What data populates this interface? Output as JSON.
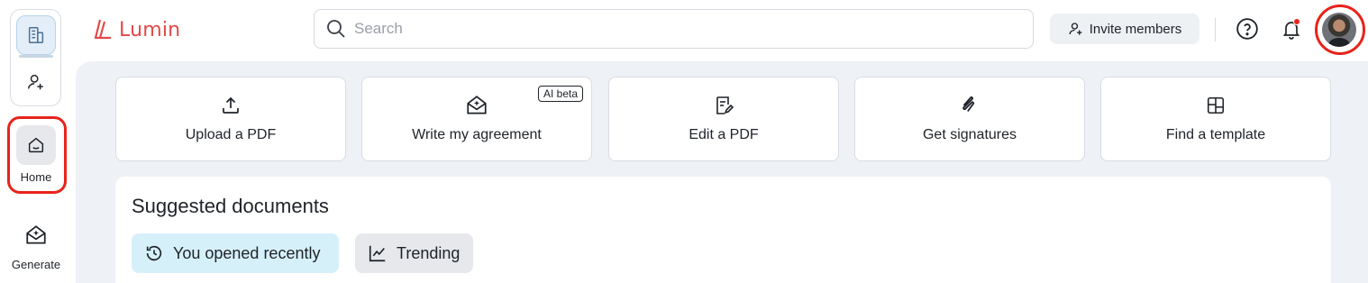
{
  "rail": {
    "workspace_icon": "building-icon",
    "add_member_icon": "user-plus-icon",
    "home_label": "Home",
    "home_icon": "home-icon",
    "generate_label": "Generate",
    "generate_icon": "envelope-sparkle-icon"
  },
  "header": {
    "brand": "Lumin",
    "search_placeholder": "Search",
    "invite_label": "Invite members",
    "icons": [
      "search-icon",
      "user-plus-icon",
      "help-icon",
      "bell-icon",
      "avatar"
    ]
  },
  "actions": [
    {
      "label": "Upload a PDF",
      "icon": "upload-icon"
    },
    {
      "label": "Write my agreement",
      "icon": "envelope-sparkle-icon",
      "badge": "AI beta"
    },
    {
      "label": "Edit a PDF",
      "icon": "edit-document-icon"
    },
    {
      "label": "Get signatures",
      "icon": "signature-icon"
    },
    {
      "label": "Find a template",
      "icon": "template-icon"
    }
  ],
  "suggested": {
    "title": "Suggested documents",
    "tabs": [
      {
        "label": "You opened recently",
        "icon": "history-icon",
        "active": true
      },
      {
        "label": "Trending",
        "icon": "trending-icon",
        "active": false
      }
    ]
  },
  "colors": {
    "brand": "#e24a48",
    "highlight_ring": "#e8231b",
    "active_chip": "#d6f0fa",
    "main_bg": "#eef1f5"
  }
}
